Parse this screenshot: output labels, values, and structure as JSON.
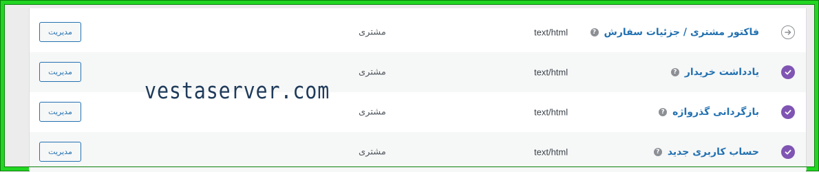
{
  "colors": {
    "frame_border": "#22d622",
    "link": "#2271b1",
    "enabled_status": "#7f54b3",
    "manual_status": "#8c8f94"
  },
  "watermark": "vestaserver.com",
  "rows": [
    {
      "status_icon": "manual-arrow-icon",
      "name": "فاکتور مشتری / جزئیات سفارش",
      "help": "?",
      "content_type": "text/html",
      "recipient": "مشتری",
      "action": "مدیریت"
    },
    {
      "status_icon": "enabled-check-icon",
      "name": "یادداشت خریدار",
      "help": "?",
      "content_type": "text/html",
      "recipient": "مشتری",
      "action": "مدیریت"
    },
    {
      "status_icon": "enabled-check-icon",
      "name": "بازگردانی گذرواژه",
      "help": "?",
      "content_type": "text/html",
      "recipient": "مشتری",
      "action": "مدیریت"
    },
    {
      "status_icon": "enabled-check-icon",
      "name": "حساب کاربری جدید",
      "help": "?",
      "content_type": "text/html",
      "recipient": "مشتری",
      "action": "مدیریت"
    }
  ]
}
